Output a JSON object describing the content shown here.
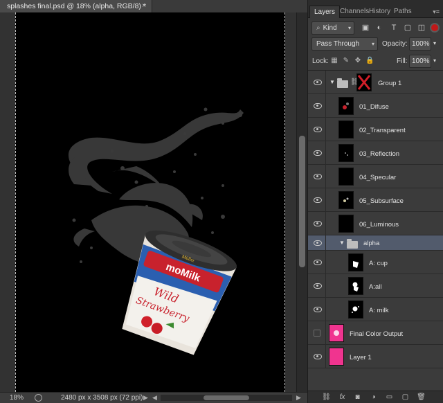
{
  "document": {
    "tab_title": "splashes final.psd @ 18% (alpha, RGB/8) *",
    "close_glyph": "×"
  },
  "status": {
    "zoom": "18%",
    "doc_info": "2480 px x 3508 px (72 ppi)",
    "arrow_left": "◀",
    "arrow_right": "▶"
  },
  "artwork": {
    "brand": "moMilk",
    "small_brand": "Müller",
    "flavor_line1": "Wild",
    "flavor_line2": "Strawberry",
    "colors": {
      "liquid": "#3a3a3a",
      "cup": "#e9e4dc",
      "brand_red": "#c8222d",
      "blue": "#2b5fb0"
    }
  },
  "panel": {
    "tabs": [
      "Layers",
      "Channels",
      "History",
      "Paths"
    ],
    "active_tab": "Layers",
    "menu_glyph": "▾≡",
    "filter": {
      "label": "Kind",
      "dd": "▾",
      "icons": [
        "image-filter-icon",
        "adjustment-filter-icon",
        "type-filter-icon",
        "shape-filter-icon",
        "smart-object-filter-icon"
      ],
      "glyphs": [
        "▣",
        "◐",
        "T",
        "▢",
        "◫"
      ]
    },
    "blend": {
      "mode": "Pass Through",
      "dd": "▾",
      "opacity_label": "Opacity:",
      "opacity": "100%",
      "opacity_dd": "▾"
    },
    "lock": {
      "label": "Lock:",
      "glyphs": [
        "▦",
        "✎",
        "✥",
        "🔒"
      ],
      "fill_label": "Fill:",
      "fill": "100%",
      "fill_dd": "▾"
    },
    "layers": [
      {
        "name": "Group 1",
        "type": "group",
        "visible": true,
        "thumb": "black-red"
      },
      {
        "name": "01_Difuse",
        "type": "layer",
        "visible": true,
        "thumb": "black"
      },
      {
        "name": "02_Transparent",
        "type": "layer",
        "visible": true,
        "thumb": "black"
      },
      {
        "name": "03_Reflection",
        "type": "layer",
        "visible": true,
        "thumb": "black"
      },
      {
        "name": "04_Specular",
        "type": "layer",
        "visible": true,
        "thumb": "black"
      },
      {
        "name": "05_Subsurface",
        "type": "layer",
        "visible": true,
        "thumb": "black"
      },
      {
        "name": "06_Luminous",
        "type": "layer",
        "visible": true,
        "thumb": "black"
      },
      {
        "name": "alpha",
        "type": "group",
        "visible": true,
        "selected": true
      },
      {
        "name": "A: cup",
        "type": "layer",
        "visible": true,
        "thumb": "black"
      },
      {
        "name": "A:all",
        "type": "layer",
        "visible": true,
        "thumb": "black"
      },
      {
        "name": "A: milk",
        "type": "layer",
        "visible": true,
        "thumb": "black"
      },
      {
        "name": "Final Color Output",
        "type": "layer",
        "visible": false,
        "thumb": "pink"
      },
      {
        "name": "Layer 1",
        "type": "layer",
        "visible": true,
        "thumb": "pink"
      }
    ],
    "bottom_icons": [
      "link-layers-icon",
      "fx-icon",
      "mask-icon",
      "adjustment-icon",
      "folder-icon",
      "new-layer-icon",
      "trash-icon"
    ],
    "bottom_glyphs": [
      "⛓",
      "fx",
      "◙",
      "◑",
      "▭",
      "▢",
      "🗑"
    ]
  }
}
